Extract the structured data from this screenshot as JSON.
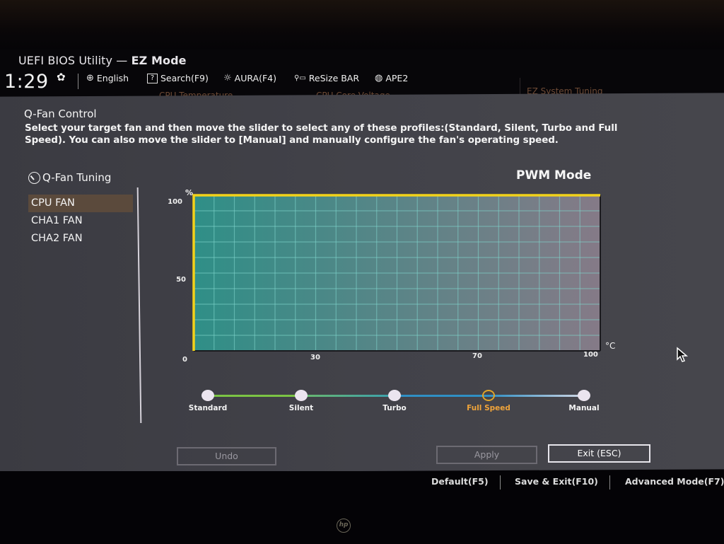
{
  "header": {
    "app_title_prefix": "UEFI BIOS Utility — ",
    "app_title_mode": "EZ Mode",
    "time": "1:29",
    "tools": [
      {
        "icon": "globe-icon",
        "label": "English"
      },
      {
        "icon": "help-box-icon",
        "glyph": "?",
        "label": "Search(F9)"
      },
      {
        "icon": "aura-light-icon",
        "label": "AURA(F4)"
      },
      {
        "icon": "resize-bar-icon",
        "label": "ReSize BAR"
      },
      {
        "icon": "cpu-ape-icon",
        "label": "APE2"
      }
    ],
    "background_tabs": [
      "CPU Temperature",
      "CPU Core Voltage",
      "EZ System Tuning"
    ]
  },
  "qfan": {
    "title": "Q-Fan Control",
    "description": "Select your target fan and then move the slider to select any of these profiles:(Standard, Silent, Turbo and Full Speed). You can also move the slider to [Manual] and manually configure the fan's operating speed.",
    "tuning_label": "Q-Fan Tuning",
    "fans": [
      {
        "label": "CPU FAN",
        "selected": true
      },
      {
        "label": "CHA1 FAN",
        "selected": false
      },
      {
        "label": "CHA2 FAN",
        "selected": false
      }
    ],
    "mode_label": "PWM Mode",
    "profiles": [
      {
        "label": "Standard",
        "active": false
      },
      {
        "label": "Silent",
        "active": false
      },
      {
        "label": "Turbo",
        "active": false
      },
      {
        "label": "Full Speed",
        "active": true
      },
      {
        "label": "Manual",
        "active": false
      }
    ],
    "selected_profile": "Full Speed",
    "buttons": {
      "undo": "Undo",
      "apply": "Apply",
      "exit": "Exit (ESC)"
    }
  },
  "chart_data": {
    "type": "area",
    "title": "",
    "xlabel": "°C",
    "ylabel": "%",
    "xlim": [
      0,
      100
    ],
    "ylim": [
      0,
      100
    ],
    "x_ticks": [
      0,
      30,
      70,
      100
    ],
    "y_ticks": [
      0,
      50,
      100
    ],
    "grid": true,
    "grid_x_step": 5,
    "grid_y_step": 10,
    "series": [
      {
        "name": "CPU FAN Full Speed curve",
        "x": [
          0,
          0,
          100
        ],
        "y": [
          0,
          100,
          100
        ],
        "color": "#f2d21a"
      }
    ],
    "fill_gradient": [
      "#2f8f87",
      "#857a87"
    ]
  },
  "footer": {
    "items": [
      "Default(F5)",
      "Save & Exit(F10)",
      "Advanced Mode(F7)"
    ]
  },
  "monitor": {
    "brand": "hp"
  }
}
